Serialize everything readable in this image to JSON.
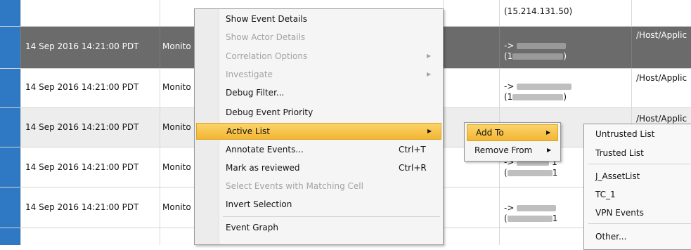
{
  "table": {
    "top_address": "(15.214.131.50)",
    "rows": [
      {
        "time": "14 Sep 2016 14:21:00 PDT",
        "name": "Monito",
        "addr1": "-> ",
        "addr2": "(1",
        "addr2_end": ")",
        "path": "/Host/Applic"
      },
      {
        "time": "14 Sep 2016 14:21:00 PDT",
        "name": "Monito",
        "addr1": "-> ",
        "addr2": "(1",
        "addr2_end": ")",
        "path": "/Host/Applic"
      },
      {
        "time": "14 Sep 2016 14:21:00 PDT",
        "name": "Monito",
        "addr1": "",
        "addr2": "",
        "addr2_end": "",
        "path": "/Host/Applic"
      },
      {
        "time": "14 Sep 2016 14:21:00 PDT",
        "name": "Monito",
        "addr1": "-> ",
        "addr2": "(",
        "addr2_end": "1",
        "path": ""
      },
      {
        "time": "14 Sep 2016 14:21:00 PDT",
        "name": "Monito",
        "addr1": "-> ",
        "addr2": "(",
        "addr2_end": "1",
        "path": ""
      }
    ]
  },
  "context_menu": {
    "items": [
      {
        "label": "Show Event Details",
        "shortcut": "",
        "submenu": false,
        "disabled": false
      },
      {
        "label": "Show Actor Details",
        "shortcut": "",
        "submenu": false,
        "disabled": true
      },
      {
        "label": "Correlation Options",
        "shortcut": "",
        "submenu": true,
        "disabled": true
      },
      {
        "label": "Investigate",
        "shortcut": "",
        "submenu": true,
        "disabled": true
      },
      {
        "label": "Debug Filter...",
        "shortcut": "",
        "submenu": false,
        "disabled": false
      },
      {
        "label": "Debug Event Priority",
        "shortcut": "",
        "submenu": false,
        "disabled": false
      },
      {
        "label": "Active List",
        "shortcut": "",
        "submenu": true,
        "disabled": false
      },
      {
        "label": "Annotate Events...",
        "shortcut": "Ctrl+T",
        "submenu": false,
        "disabled": false
      },
      {
        "label": "Mark as reviewed",
        "shortcut": "Ctrl+R",
        "submenu": false,
        "disabled": false
      },
      {
        "label": "Select Events with Matching Cell",
        "shortcut": "",
        "submenu": false,
        "disabled": true
      },
      {
        "label": "Invert Selection",
        "shortcut": "",
        "submenu": false,
        "disabled": false
      },
      {
        "label": "Event Graph",
        "shortcut": "",
        "submenu": false,
        "disabled": false
      }
    ],
    "highlighted": "Active List"
  },
  "active_list_submenu": {
    "items": [
      {
        "label": "Add To",
        "submenu": true
      },
      {
        "label": "Remove From",
        "submenu": true
      }
    ],
    "highlighted": "Add To"
  },
  "add_to_submenu": {
    "items": [
      {
        "label": "Untrusted List"
      },
      {
        "label": "Trusted List"
      },
      {
        "label": "J_AssetList"
      },
      {
        "label": "TC_1"
      },
      {
        "label": "VPN Events"
      },
      {
        "label": "Other..."
      }
    ]
  },
  "icons": {
    "submenu_arrow": "▶"
  },
  "colors": {
    "row_marker": "#2f78c4",
    "selected_row": "#6b6b6b",
    "highlight": "#f3b534"
  }
}
